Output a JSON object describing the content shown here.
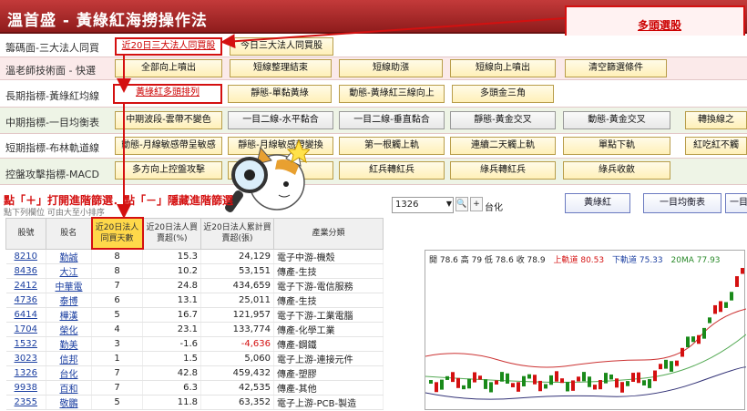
{
  "title": "溫首盛 - 黃綠紅海撈操作法",
  "callout": "多頭選股",
  "rows": [
    {
      "label": "籌碼面-三大法人同買",
      "buttons": [
        "近20日三大法人同買股",
        "今日三大法人同買股"
      ]
    },
    {
      "label": "溫老師技術面 - 快選",
      "buttons": [
        "全部向上噴出",
        "短線整理結束",
        "短線助漲",
        "短線向上噴出",
        "清空篩選條件"
      ]
    },
    {
      "label": "長期指標-黃綠紅均線",
      "buttons": [
        "黃綠紅多頭排列",
        "靜態-單黏黃綠",
        "動態-黃綠紅三線向上",
        "多頭金三角"
      ]
    },
    {
      "label": "中期指標-一目均衡表",
      "buttons": [
        "中期波段-雲帶不變色",
        "一目二線-水平黏合",
        "一目二線-垂直黏合",
        "靜態-黃金交叉",
        "動態-黃金交叉",
        "轉換線之"
      ]
    },
    {
      "label": "短期指標-布林軌道線",
      "buttons": [
        "動態-月線敏感帶呈敏感",
        "靜態-月線敏感帶變換",
        "第一根觸上軌",
        "連續二天觸上軌",
        "單點下軌",
        "紅吃紅不觸"
      ]
    },
    {
      "label": "控盤攻擊指標-MACD",
      "buttons": [
        "多方向上控盤攻擊",
        "",
        "紅兵轉紅兵",
        "綠兵轉紅兵",
        "綠兵收斂"
      ]
    }
  ],
  "filter_hint": "點「＋」打開進階篩選．點「－」隱藏進階篩選",
  "filter_sub": "點下列欄位 可由大至小排序",
  "stock_input": "1326",
  "stock_name": "台化",
  "toolbar": [
    "黃綠紅",
    "一目均衡表",
    "一目"
  ],
  "table": {
    "headers": [
      "股號",
      "股名",
      "近20日法人同買天數",
      "近20日法人買賣超(%)",
      "近20日法人累計買賣超(張)",
      "產業分類"
    ],
    "rows": [
      [
        "8210",
        "勤誠",
        "8",
        "15.3",
        "24,129",
        "電子中游-機殼"
      ],
      [
        "8436",
        "大江",
        "8",
        "10.2",
        "53,151",
        "傳產-生技"
      ],
      [
        "2412",
        "中華電",
        "7",
        "24.8",
        "434,659",
        "電子下游-電信服務"
      ],
      [
        "4736",
        "泰博",
        "6",
        "13.1",
        "25,011",
        "傳產-生技"
      ],
      [
        "6414",
        "樺漢",
        "5",
        "16.7",
        "121,957",
        "電子下游-工業電腦"
      ],
      [
        "1704",
        "榮化",
        "4",
        "23.1",
        "133,774",
        "傳產-化學工業"
      ],
      [
        "1532",
        "勤美",
        "3",
        "-1.6",
        "-4,636",
        "傳產-鋼鐵"
      ],
      [
        "3023",
        "信邦",
        "1",
        "1.5",
        "5,060",
        "電子上游-連接元件"
      ],
      [
        "1326",
        "台化",
        "7",
        "42.8",
        "459,432",
        "傳產-塑膠"
      ],
      [
        "9938",
        "百和",
        "7",
        "6.3",
        "42,535",
        "傳產-其他"
      ],
      [
        "2355",
        "敬鵬",
        "5",
        "11.8",
        "63,352",
        "電子上游-PCB-製造"
      ]
    ]
  },
  "chart": {
    "info": "開 78.6 高 79 低 78.6 收 78.9",
    "upper": "上軌道 80.53",
    "lower": "下軌道 75.33",
    "ma": "20MA 77.93"
  },
  "colors": {
    "accent": "#d41010",
    "title_bg": "#a82626",
    "button_bg": "#fff0b8"
  }
}
